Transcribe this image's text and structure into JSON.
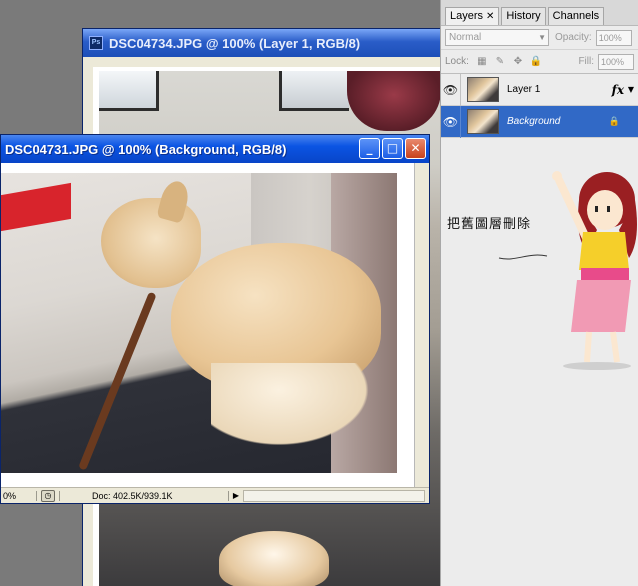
{
  "windows": {
    "back": {
      "title": "DSC04734.JPG @ 100% (Layer 1, RGB/8)",
      "app_icon": "Ps"
    },
    "front": {
      "title": "DSC04731.JPG @ 100% (Background, RGB/8)",
      "controls": {
        "minimize": "_",
        "maximize": "□",
        "close": "✕"
      },
      "status": {
        "zoom": "0%",
        "doc": "Doc: 402.5K/939.1K"
      }
    }
  },
  "layers_panel": {
    "tabs": [
      {
        "label": "Layers",
        "close": "✕"
      },
      {
        "label": "History"
      },
      {
        "label": "Channels"
      }
    ],
    "blend_mode": "Normal",
    "opacity_label": "Opacity:",
    "opacity_value": "100%",
    "lock_label": "Lock:",
    "fill_label": "Fill:",
    "fill_value": "100%",
    "layers": [
      {
        "name": "Layer 1",
        "fx": "fx"
      },
      {
        "name": "Background"
      }
    ]
  },
  "annotation": {
    "caption": "把舊圖層刪除"
  },
  "colors": {
    "xp_title_active": "#0b54e3",
    "selection_blue": "#3169c6",
    "close_red": "#c8421c"
  }
}
